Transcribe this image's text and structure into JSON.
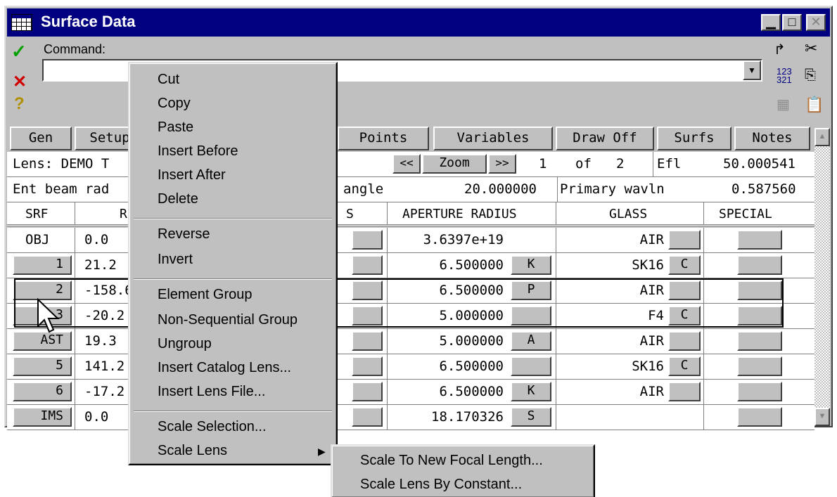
{
  "window": {
    "title": "Surface Data"
  },
  "command": {
    "label": "Command:",
    "value": ""
  },
  "tabs": [
    "Gen",
    "Setup",
    "Points",
    "Variables",
    "Draw Off",
    "Surfs",
    "Notes"
  ],
  "info1": {
    "lens": "Lens: DEMO T",
    "prev": "<<",
    "zoom": "Zoom",
    "next": ">>",
    "page": "1",
    "of": "of",
    "total": "2",
    "efl_label": "Efl",
    "efl_value": "50.000541"
  },
  "info2": {
    "ent": "Ent beam rad",
    "angle": "angle",
    "angle_value": "20.000000",
    "wavln_label": "Primary wavln",
    "wavln_value": "0.587560"
  },
  "headers": {
    "srf": "SRF",
    "radius": "R",
    "s": "S",
    "aperture": "APERTURE RADIUS",
    "glass": "GLASS",
    "special": "SPECIAL"
  },
  "rows": [
    {
      "srf": "OBJ",
      "srf_button": false,
      "radius": "0.0",
      "aperture": "3.6397e+19",
      "ap_flag": null,
      "glass": "AIR",
      "glass_flag": ""
    },
    {
      "srf": "1",
      "srf_button": true,
      "radius": "21.2",
      "aperture": "6.500000",
      "ap_flag": "K",
      "glass": "SK16",
      "glass_flag": "C"
    },
    {
      "srf": "2",
      "srf_button": true,
      "radius": "-158.6",
      "aperture": "6.500000",
      "ap_flag": "P",
      "glass": "AIR",
      "glass_flag": ""
    },
    {
      "srf": "3",
      "srf_button": true,
      "radius": "-20.2",
      "aperture": "5.000000",
      "ap_flag": "",
      "glass": "F4",
      "glass_flag": "C"
    },
    {
      "srf": "AST",
      "srf_button": true,
      "radius": "19.3",
      "aperture": "5.000000",
      "ap_flag": "A",
      "glass": "AIR",
      "glass_flag": ""
    },
    {
      "srf": "5",
      "srf_button": true,
      "radius": "141.2",
      "aperture": "6.500000",
      "ap_flag": "",
      "glass": "SK16",
      "glass_flag": "C"
    },
    {
      "srf": "6",
      "srf_button": true,
      "radius": "-17.2",
      "aperture": "6.500000",
      "ap_flag": "K",
      "glass": "AIR",
      "glass_flag": ""
    },
    {
      "srf": "IMS",
      "srf_button": true,
      "radius": "0.0",
      "aperture": "18.170326",
      "ap_flag": "S",
      "glass": "",
      "glass_flag": null
    }
  ],
  "context_menu": {
    "cut": "Cut",
    "copy": "Copy",
    "paste": "Paste",
    "insert_before": "Insert Before",
    "insert_after": "Insert After",
    "delete": "Delete",
    "reverse": "Reverse",
    "invert": "Invert",
    "element_group": "Element Group",
    "non_sequential_group": "Non-Sequential Group",
    "ungroup": "Ungroup",
    "insert_catalog_lens": "Insert Catalog Lens...",
    "insert_lens_file": "Insert Lens File...",
    "scale_selection": "Scale Selection...",
    "scale_lens": "Scale Lens"
  },
  "submenu": {
    "scale_focal": "Scale To New Focal Length...",
    "scale_constant": "Scale Lens By Constant..."
  },
  "colors": {
    "titlebar": "#000080",
    "face": "#c0c0c0",
    "ok": "#00a000",
    "cancel": "#d00000",
    "help": "#e0c000"
  }
}
